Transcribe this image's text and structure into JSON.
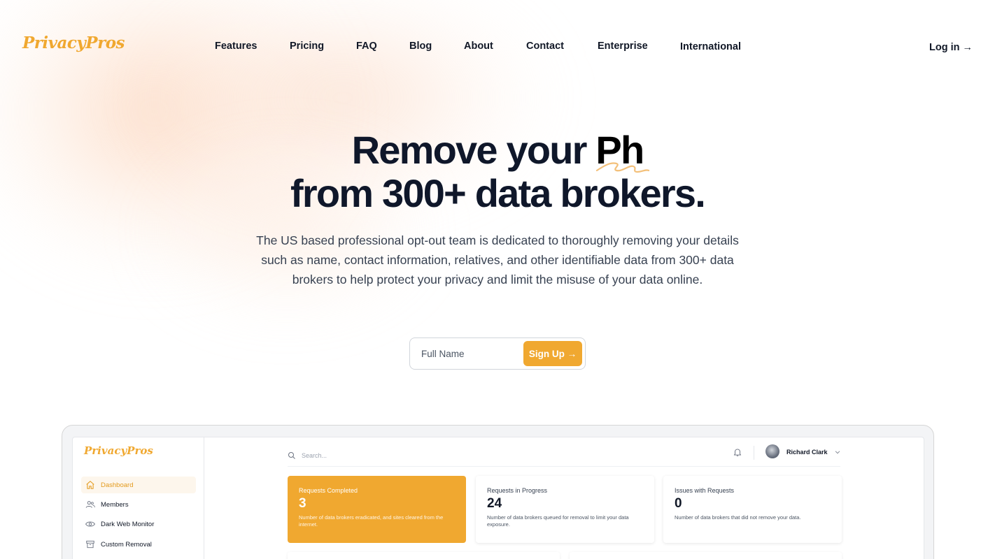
{
  "brand": {
    "name": "PrivacyPros",
    "accent": "#f0a830"
  },
  "nav": {
    "links": [
      "Features",
      "Pricing",
      "FAQ",
      "Blog",
      "About",
      "Contact",
      "Enterprise",
      "International"
    ],
    "login": "Log in →"
  },
  "hero": {
    "title_line1": "Remove your ",
    "title_typed": "Ph",
    "title_line2": "from 300+ data brokers.",
    "description": "The US based professional opt-out team is dedicated to thoroughly removing your details such as name, contact information, relatives, and other identifiable data from 300+ data brokers to help protect your privacy and limit the misuse of your data online."
  },
  "signup": {
    "placeholder": "Full Name",
    "button": "Sign Up →"
  },
  "dashboard": {
    "logo": "PrivacyPros",
    "sidebar": [
      {
        "label": "Dashboard",
        "icon": "home-icon",
        "active": true
      },
      {
        "label": "Members",
        "icon": "users-icon",
        "active": false
      },
      {
        "label": "Dark Web Monitor",
        "icon": "eye-icon",
        "active": false
      },
      {
        "label": "Custom Removal",
        "icon": "archive-icon",
        "active": false
      }
    ],
    "search_placeholder": "Search...",
    "user_name": "Richard Clark",
    "cards": [
      {
        "title": "Requests Completed",
        "value": "3",
        "desc": "Number of data brokers eradicated, and sites cleared from the internet."
      },
      {
        "title": "Requests in Progress",
        "value": "24",
        "desc": "Number of data brokers queued for removal to limit your data exposure."
      },
      {
        "title": "Issues with Requests",
        "value": "0",
        "desc": "Number of data brokers that did not remove your data."
      }
    ]
  }
}
